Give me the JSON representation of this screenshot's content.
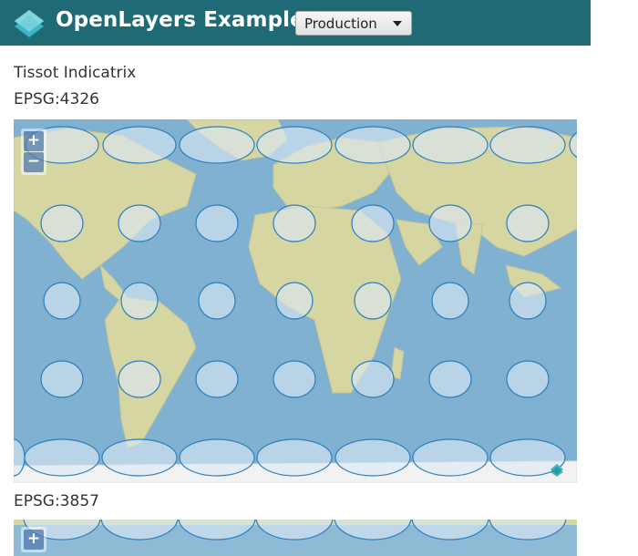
{
  "header": {
    "brand": "OpenLayers Examples",
    "version_select": "Production"
  },
  "page": {
    "title": "Tissot Indicatrix"
  },
  "maps": [
    {
      "heading": "EPSG:4326",
      "zoom_in": "+",
      "zoom_out": "−"
    },
    {
      "heading": "EPSG:3857",
      "zoom_in": "+"
    }
  ],
  "colors": {
    "header_bg": "#1f6b75",
    "ocean": "#7fb0cf",
    "land": "#d8d7a5",
    "tissot_fill": "#dce8f6",
    "tissot_stroke": "#2b7fbf"
  },
  "icons": [
    "openlayers-logo-icon",
    "chevron-down-icon",
    "attribution-icon"
  ]
}
